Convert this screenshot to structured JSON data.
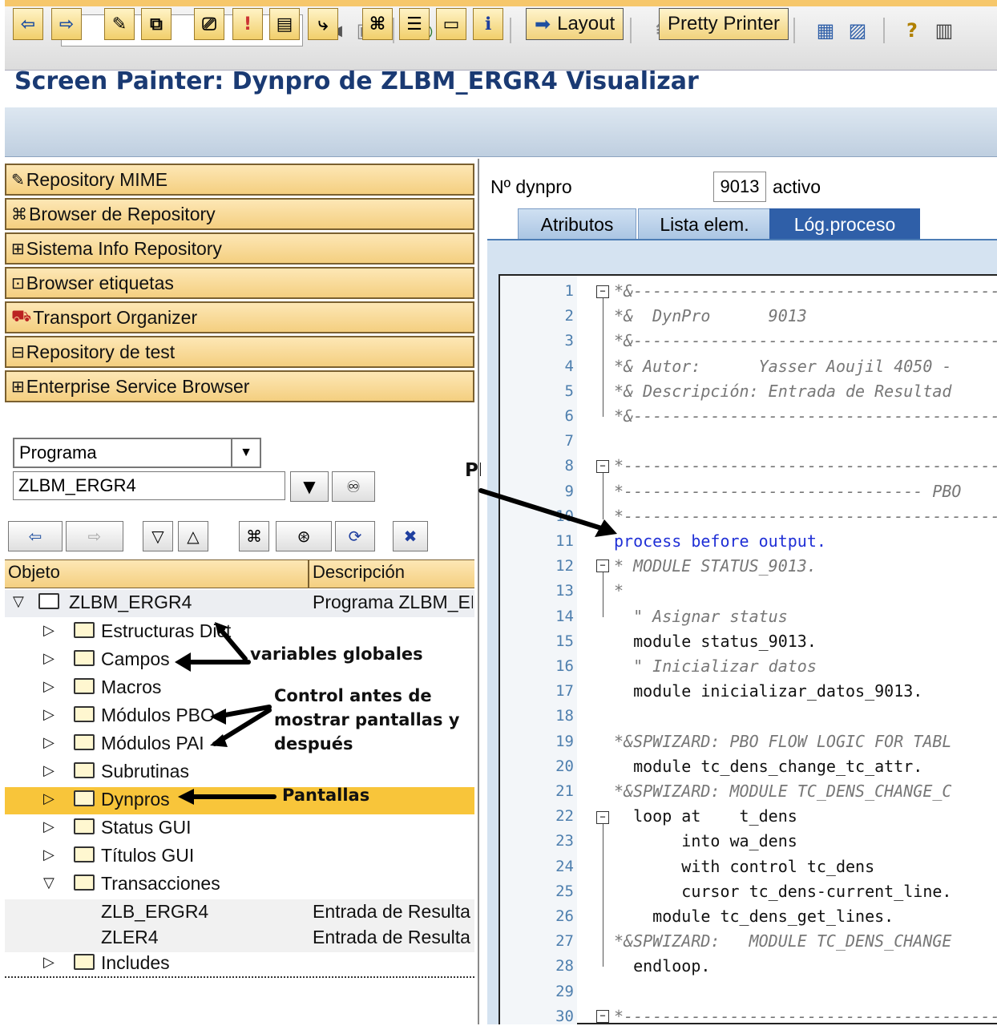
{
  "window": {
    "title": "Screen Painter: Dynpro de ZLBM_ERGR4 Visualizar"
  },
  "app_toolbar": {
    "layout_label": "Layout",
    "pretty_printer_label": "Pretty Printer"
  },
  "nav_buttons": [
    {
      "label": "Repository MIME",
      "icon": "pencil-icon"
    },
    {
      "label": "Browser de Repository",
      "icon": "hierarchy-icon"
    },
    {
      "label": "Sistema Info Repository",
      "icon": "info-system-icon"
    },
    {
      "label": "Browser etiquetas",
      "icon": "tag-icon"
    },
    {
      "label": "Transport Organizer",
      "icon": "truck-icon"
    },
    {
      "label": "Repository de test",
      "icon": "test-icon"
    },
    {
      "label": "Enterprise Service Browser",
      "icon": "services-icon"
    }
  ],
  "object_type": {
    "value": "Programa"
  },
  "object_name": {
    "value": "ZLBM_ERGR4"
  },
  "tree": {
    "col_object": "Objeto",
    "col_description": "Descripción",
    "root": {
      "label": "ZLBM_ERGR4",
      "description": "Programa ZLBM_ER"
    },
    "items": [
      {
        "label": "Estructuras Dict"
      },
      {
        "label": "Campos"
      },
      {
        "label": "Macros"
      },
      {
        "label": "Módulos PBO"
      },
      {
        "label": "Módulos PAI"
      },
      {
        "label": "Subrutinas"
      },
      {
        "label": "Dynpros"
      },
      {
        "label": "Status GUI"
      },
      {
        "label": "Títulos GUI"
      },
      {
        "label": "Transacciones"
      }
    ],
    "transactions": [
      {
        "label": "ZLB_ERGR4",
        "description": "Entrada de Resulta"
      },
      {
        "label": "ZLER4",
        "description": "Entrada de Resulta"
      }
    ],
    "includes": {
      "label": "Includes"
    }
  },
  "annotations": {
    "variables": "variables globales",
    "control_1": "Control antes de",
    "control_2": "mostrar pantallas y",
    "control_3": "después",
    "pantallas": "Pantallas",
    "pbo": "PBO"
  },
  "dynpro": {
    "label": "Nº dynpro",
    "number": "9013",
    "status": "activo"
  },
  "tabs": [
    {
      "label": "Atributos"
    },
    {
      "label": "Lista elem."
    },
    {
      "label": "Lóg.proceso"
    }
  ],
  "code_lines": [
    {
      "n": "1",
      "text": "*&---------------------------------------------",
      "cls": "cm"
    },
    {
      "n": "2",
      "text": "*&  DynPro      9013",
      "cls": "cm"
    },
    {
      "n": "3",
      "text": "*&---------------------------------------------",
      "cls": "cm"
    },
    {
      "n": "4",
      "text": "*& Autor:      Yasser Aoujil 4050 -",
      "cls": "cm"
    },
    {
      "n": "5",
      "text": "*& Descripción: Entrada de Resultad",
      "cls": "cm"
    },
    {
      "n": "6",
      "text": "*&---------------------------------------------",
      "cls": "cm"
    },
    {
      "n": "7",
      "text": "",
      "cls": "tx"
    },
    {
      "n": "8",
      "text": "*----------------------------------------------",
      "cls": "cm"
    },
    {
      "n": "9",
      "text": "*------------------------------- PBO",
      "cls": "cm"
    },
    {
      "n": "10",
      "text": "*----------------------------------------------",
      "cls": "cm"
    },
    {
      "n": "11",
      "text": "process before output.",
      "cls": "kw"
    },
    {
      "n": "12",
      "text": "* MODULE STATUS_9013.",
      "cls": "cm"
    },
    {
      "n": "13",
      "text": "*",
      "cls": "cm"
    },
    {
      "n": "14",
      "text": "  \" Asignar status",
      "cls": "cm"
    },
    {
      "n": "15",
      "text": "  module status_9013.",
      "cls": "tx"
    },
    {
      "n": "16",
      "text": "  \" Inicializar datos",
      "cls": "cm"
    },
    {
      "n": "17",
      "text": "  module inicializar_datos_9013.",
      "cls": "tx"
    },
    {
      "n": "18",
      "text": "",
      "cls": "tx"
    },
    {
      "n": "19",
      "text": "*&SPWIZARD: PBO FLOW LOGIC FOR TABL",
      "cls": "cm"
    },
    {
      "n": "20",
      "text": "  module tc_dens_change_tc_attr.",
      "cls": "tx"
    },
    {
      "n": "21",
      "text": "*&SPWIZARD: MODULE TC_DENS_CHANGE_C",
      "cls": "cm"
    },
    {
      "n": "22",
      "text": "  loop at    t_dens",
      "cls": "tx"
    },
    {
      "n": "23",
      "text": "       into wa_dens",
      "cls": "tx"
    },
    {
      "n": "24",
      "text": "       with control tc_dens",
      "cls": "tx"
    },
    {
      "n": "25",
      "text": "       cursor tc_dens-current_line.",
      "cls": "tx"
    },
    {
      "n": "26",
      "text": "    module tc_dens_get_lines.",
      "cls": "tx"
    },
    {
      "n": "27",
      "text": "*&SPWIZARD:   MODULE TC_DENS_CHANGE",
      "cls": "cm"
    },
    {
      "n": "28",
      "text": "  endloop.",
      "cls": "tx"
    },
    {
      "n": "29",
      "text": "",
      "cls": "tx"
    },
    {
      "n": "30",
      "text": "*----------------------------------------------",
      "cls": "cm"
    }
  ],
  "colors": {
    "title": "#1a3a73",
    "keyword": "#1f2fd6",
    "comment": "#777777",
    "selection": "#f8c53a",
    "active_tab": "#2f5fa8"
  }
}
